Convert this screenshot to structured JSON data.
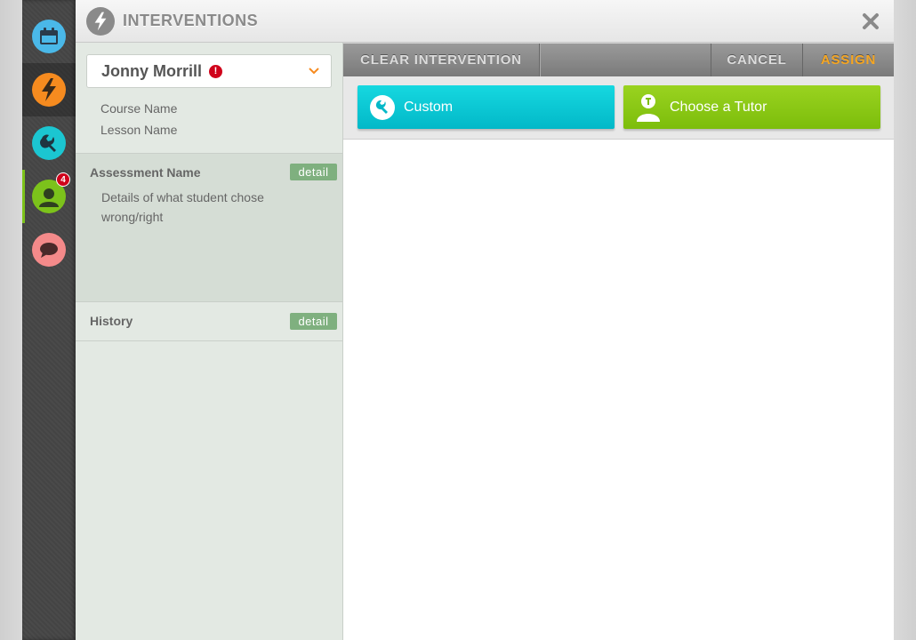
{
  "rail": {
    "items": [
      {
        "icon": "calendar-icon",
        "color": "#4ab8e8"
      },
      {
        "icon": "lightning-icon",
        "color": "#f68b1f"
      },
      {
        "icon": "wrench-icon",
        "color": "#1bc6d1"
      },
      {
        "icon": "students-icon",
        "color": "#7cc21b",
        "badge": "4"
      },
      {
        "icon": "chat-icon",
        "color": "#f48a8a"
      }
    ]
  },
  "header": {
    "title": "INTERVENTIONS"
  },
  "student": {
    "name": "Jonny Morrill",
    "alert": "!",
    "course": "Course Name",
    "lesson": "Lesson Name"
  },
  "assessment": {
    "title": "Assessment Name",
    "detail_label": "detail",
    "details": "Details of what student chose wrong/right"
  },
  "history": {
    "title": "History",
    "detail_label": "detail"
  },
  "toolbar": {
    "clear_label": "CLEAR INTERVENTION",
    "cancel_label": "CANCEL",
    "assign_label": "ASSIGN"
  },
  "actions": {
    "custom_label": "Custom",
    "tutor_label": "Choose a Tutor"
  }
}
